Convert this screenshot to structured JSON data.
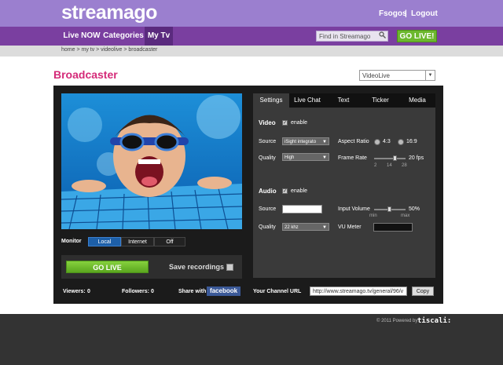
{
  "brand": "streamago",
  "user": {
    "name": "Fsogos",
    "separator": "|",
    "logout": "Logout"
  },
  "nav": {
    "items": [
      "Live NOW",
      "Categories",
      "My Tv"
    ],
    "active": "My Tv"
  },
  "search": {
    "placeholder": "Find in Streamago"
  },
  "golive_top": "GO LIVE!",
  "breadcrumb": "home > my tv > videolive > broadcaster",
  "page_title": "Broadcaster",
  "channel_select": "VideoLive",
  "monitor": {
    "label": "Monitor",
    "options": [
      "Local",
      "Internet",
      "Off"
    ],
    "selected": "Local"
  },
  "golive_button": "GO LIVE",
  "save_recordings": "Save recordings",
  "stats": {
    "viewers_label": "Viewers:",
    "viewers": "0",
    "followers_label": "Followers:",
    "followers": "0",
    "share_label": "Share with",
    "facebook": "facebook"
  },
  "tabs": [
    "Settings",
    "Live Chat",
    "Text",
    "Ticker",
    "Media"
  ],
  "active_tab": "Settings",
  "video": {
    "heading": "Video",
    "enable_label": "enable",
    "source_label": "Source",
    "source_value": "iSight integrato",
    "quality_label": "Quality",
    "quality_value": "High",
    "aspect_label": "Aspect Ratio",
    "aspect_opt1": "4:3",
    "aspect_opt2": "16:9",
    "framerate_label": "Frame Rate",
    "framerate_value": "20 fps",
    "framerate_ticks": [
      "2",
      "14",
      "28"
    ]
  },
  "audio": {
    "heading": "Audio",
    "enable_label": "enable",
    "source_label": "Source",
    "source_value": "",
    "volume_label": "Input Volume",
    "volume_value": "50%",
    "volume_min": "min",
    "volume_max": "max",
    "quality_label": "Quality",
    "quality_value": "22 khz",
    "vu_label": "VU Meter"
  },
  "channel_url": {
    "label": "Your Channel URL",
    "value": "http://www.streamago.tv/general/96/v",
    "copy": "Copy"
  },
  "footer": {
    "text": "© 2011 Powered by",
    "brand": "tiscali:"
  },
  "colors": {
    "top_bar": "#9b7fcf",
    "nav_bar": "#7a3fa0",
    "title": "#d42a78",
    "go_live": "#6cb82d",
    "panel": "#1b1b1b"
  }
}
